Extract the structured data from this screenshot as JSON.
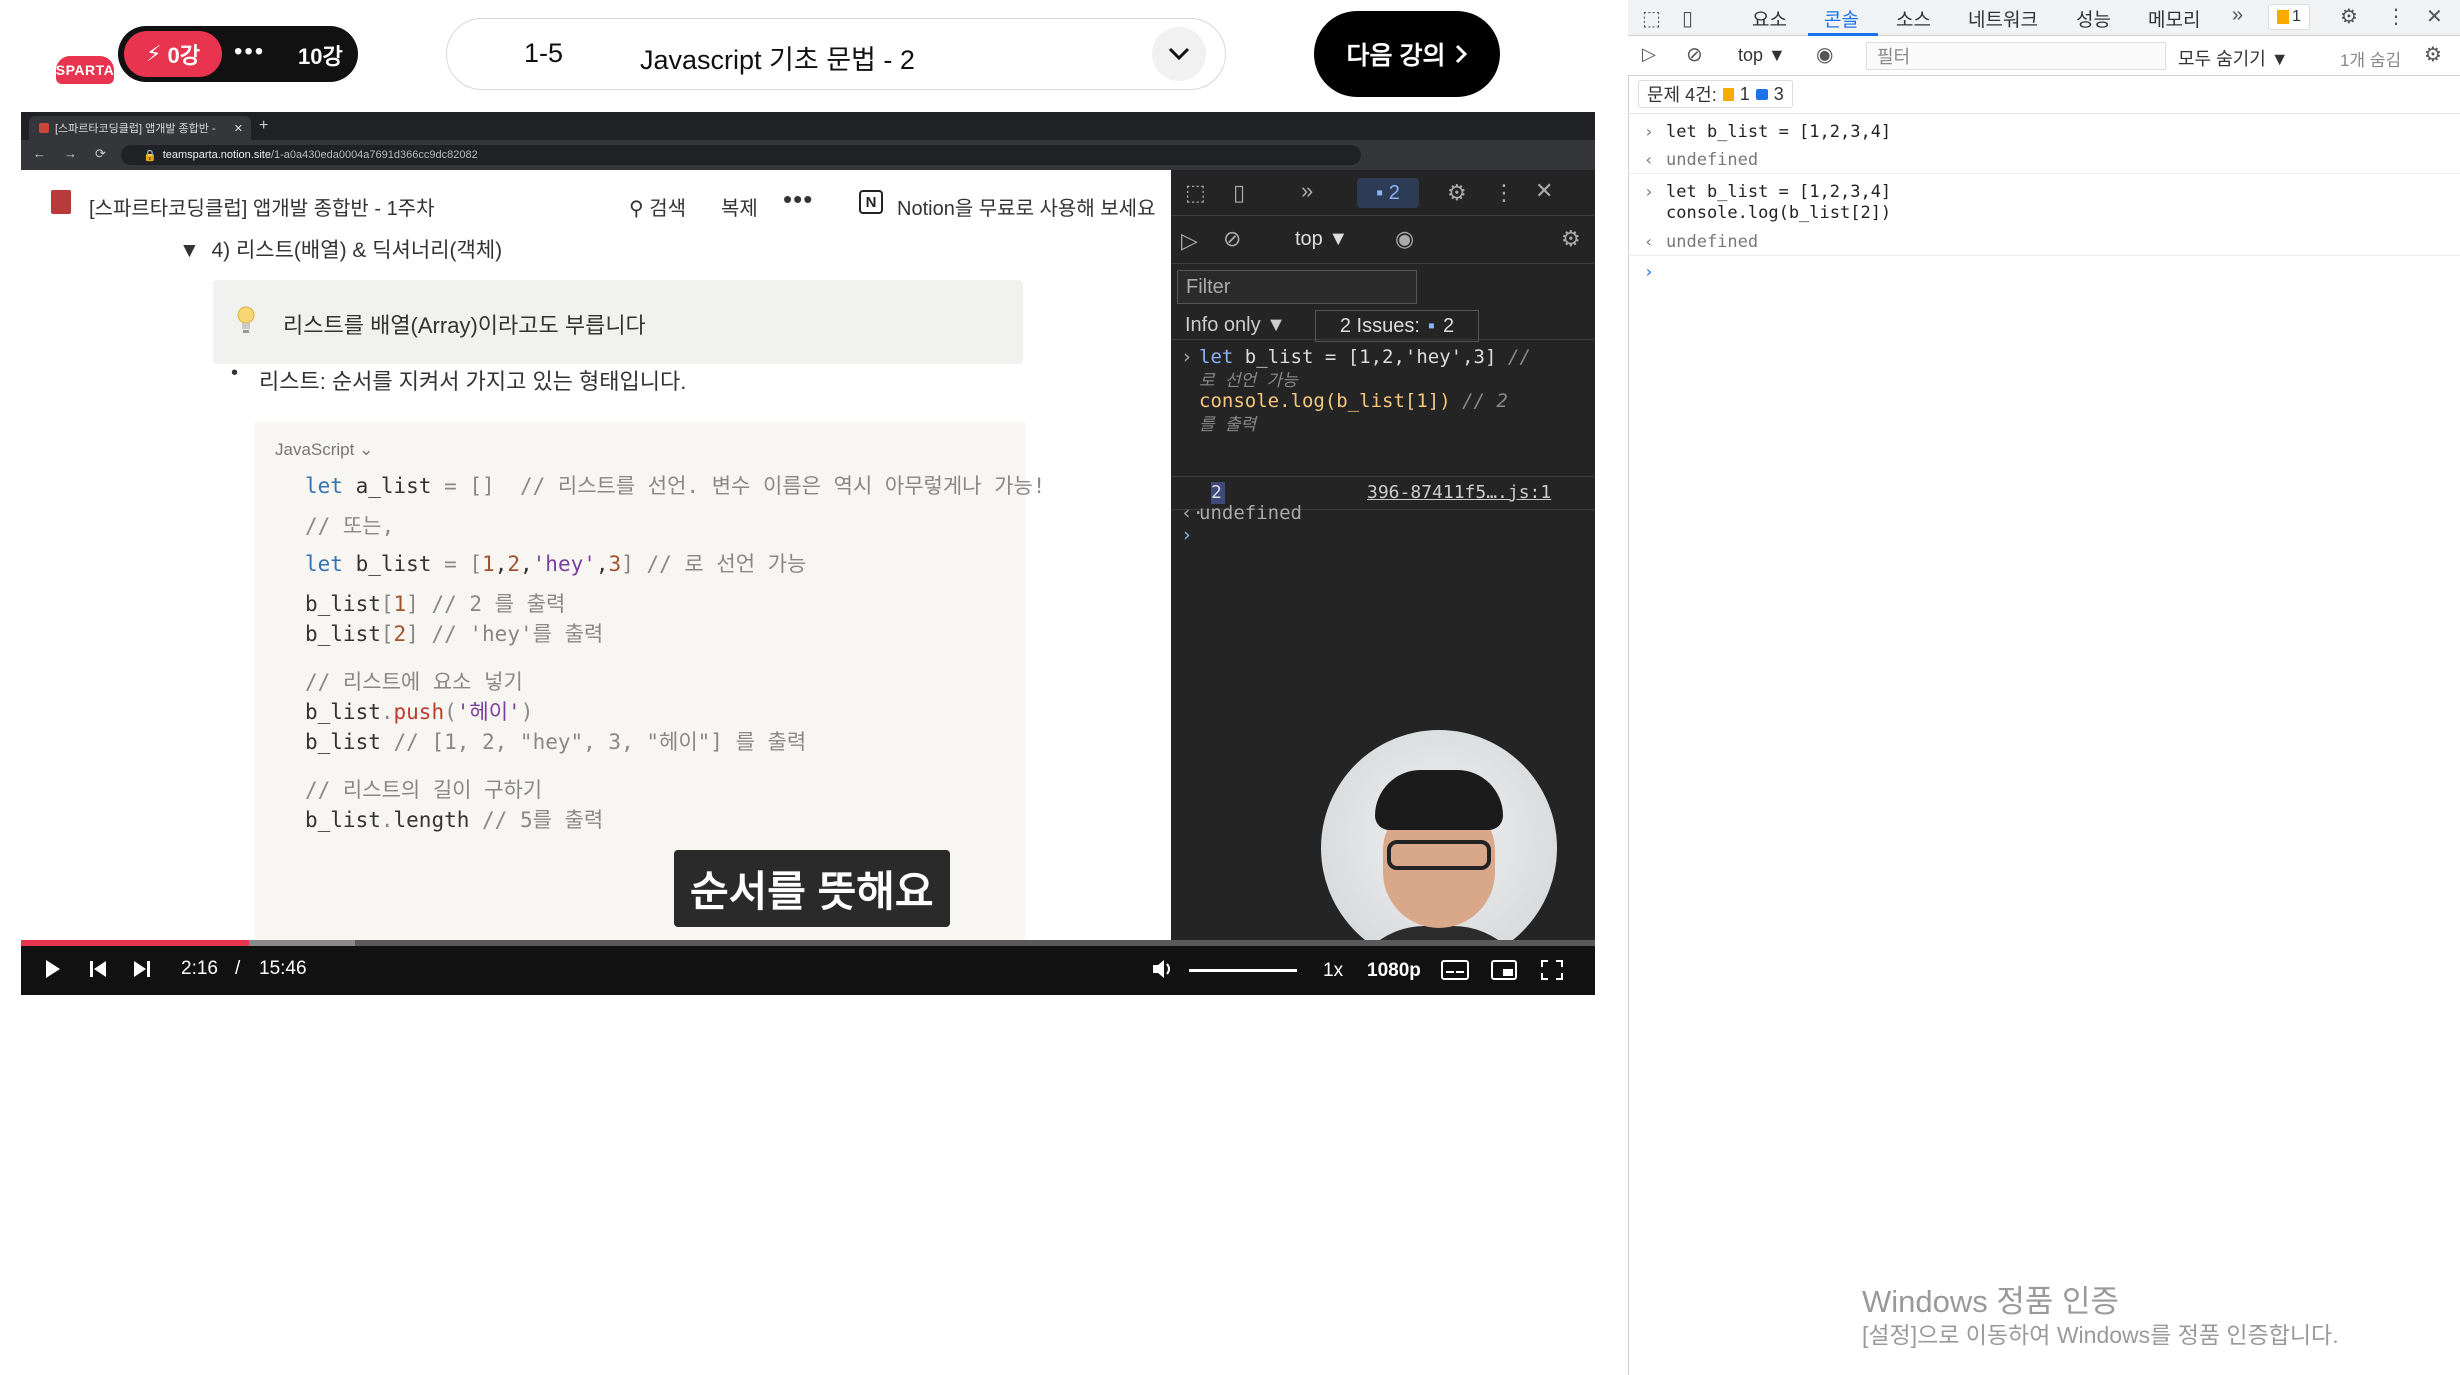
{
  "course_bar": {
    "logo_text": "SPARTA",
    "current_lesson": "0강",
    "total_lessons": "10강",
    "lesson_number": "1-5",
    "lesson_title": "Javascript 기초 문법 - 2",
    "next_button": "다음 강의"
  },
  "video": {
    "browser": {
      "tab_title": "[스파르타코딩클럽] 앱개발 종합반 -",
      "url_host": "teamsparta.notion.site",
      "url_path": "/1-a0a430eda0004a7691d366cc9dc82082"
    },
    "notion": {
      "page_title": "[스파르타코딩클럽] 앱개발 종합반 - 1주차",
      "search": "검색",
      "duplicate": "복제",
      "cta": "Notion을 무료로 사용해 보세요",
      "toggle_heading": "4) 리스트(배열) & 딕셔너리(객체)",
      "callout": "리스트를 배열(Array)이라고도 부릅니다",
      "bullet": "리스트: 순서를 지켜서 가지고 있는 형태입니다.",
      "code_language": "JavaScript",
      "code": {
        "l1_kw": "let",
        "l1_var": " a_list ",
        "l1_op": "= []",
        "l1_cmt": "  // 리스트를 선언. 변수 이름은 역시 아무렇게나 가능!",
        "l2_cmt": "// 또는,",
        "l3_kw": "let",
        "l3_var": " b_list ",
        "l3_op": "= [",
        "l3_n1": "1",
        "l3_c1": ",",
        "l3_n2": "2",
        "l3_c2": ",",
        "l3_s": "'hey'",
        "l3_c3": ",",
        "l3_n3": "3",
        "l3_close": "]",
        "l3_cmt": " // 로 선언 가능",
        "l4_var": "b_list",
        "l4_idx_open": "[",
        "l4_idx": "1",
        "l4_idx_close": "]",
        "l4_cmt": " // 2 를 출력",
        "l5_var": "b_list",
        "l5_idx_open": "[",
        "l5_idx": "2",
        "l5_idx_close": "]",
        "l5_cmt": " // 'hey'를 출력",
        "l6_cmt": "// 리스트에 요소 넣기",
        "l7_var": "b_list",
        "l7_dot": ".",
        "l7_fn": "push",
        "l7_open": "(",
        "l7_s": "'헤이'",
        "l7_close": ")",
        "l8_var": "b_list",
        "l8_cmt": " // [1, 2, \"hey\", 3, \"헤이\"] 를 출력",
        "l9_cmt": "// 리스트의 길이 구하기",
        "l10_var": "b_list",
        "l10_dot": ".",
        "l10_prop": "length",
        "l10_cmt": " // 5를 출력"
      }
    },
    "inner_devtools": {
      "issues_count": "2",
      "context": "top ▼",
      "filter_placeholder": "Filter",
      "level": "Info only ▼",
      "issues_label": "2 Issues:",
      "issues_badge": "2",
      "line1_kw": "let",
      "line1_rest": " b_list = [1,2,'hey',3]",
      "line1_cmt": " //",
      "line2_cmt": "로 선언 가능",
      "line3_code": "console.log(b_list[1])",
      "line3_cmt": " // 2",
      "line4_cmt": "를 출력",
      "result_value": "2",
      "result_source": "396-87411f5….js:1",
      "undefined": "undefined"
    },
    "subtitle": "순서를 뜻해요",
    "controls": {
      "time_current": "2:16",
      "time_separator": "/",
      "time_total": "15:46",
      "speed": "1x",
      "quality": "1080p",
      "progress_fraction": 0.145
    }
  },
  "devtools": {
    "tabs": [
      "요소",
      "콘솔",
      "소스",
      "네트워크",
      "성능",
      "메모리"
    ],
    "active_tab": "콘솔",
    "warning_count": "1",
    "context": "top ▼",
    "filter_placeholder": "필터",
    "levels": "모두 숨기기 ▼",
    "hidden_count": "1개 숨김",
    "issues_summary_label": "문제 4건:",
    "issues_warn": "1",
    "issues_info": "3",
    "entries": [
      {
        "input": "let b_list = [1,2,3,4]",
        "output": "undefined"
      },
      {
        "input": "let b_list = [1,2,3,4]\nconsole.log(b_list[2])",
        "output": "undefined"
      }
    ]
  },
  "windows_watermark": {
    "title": "Windows 정품 인증",
    "subtitle": "[설정]으로 이동하여 Windows를 정품 인증합니다."
  }
}
